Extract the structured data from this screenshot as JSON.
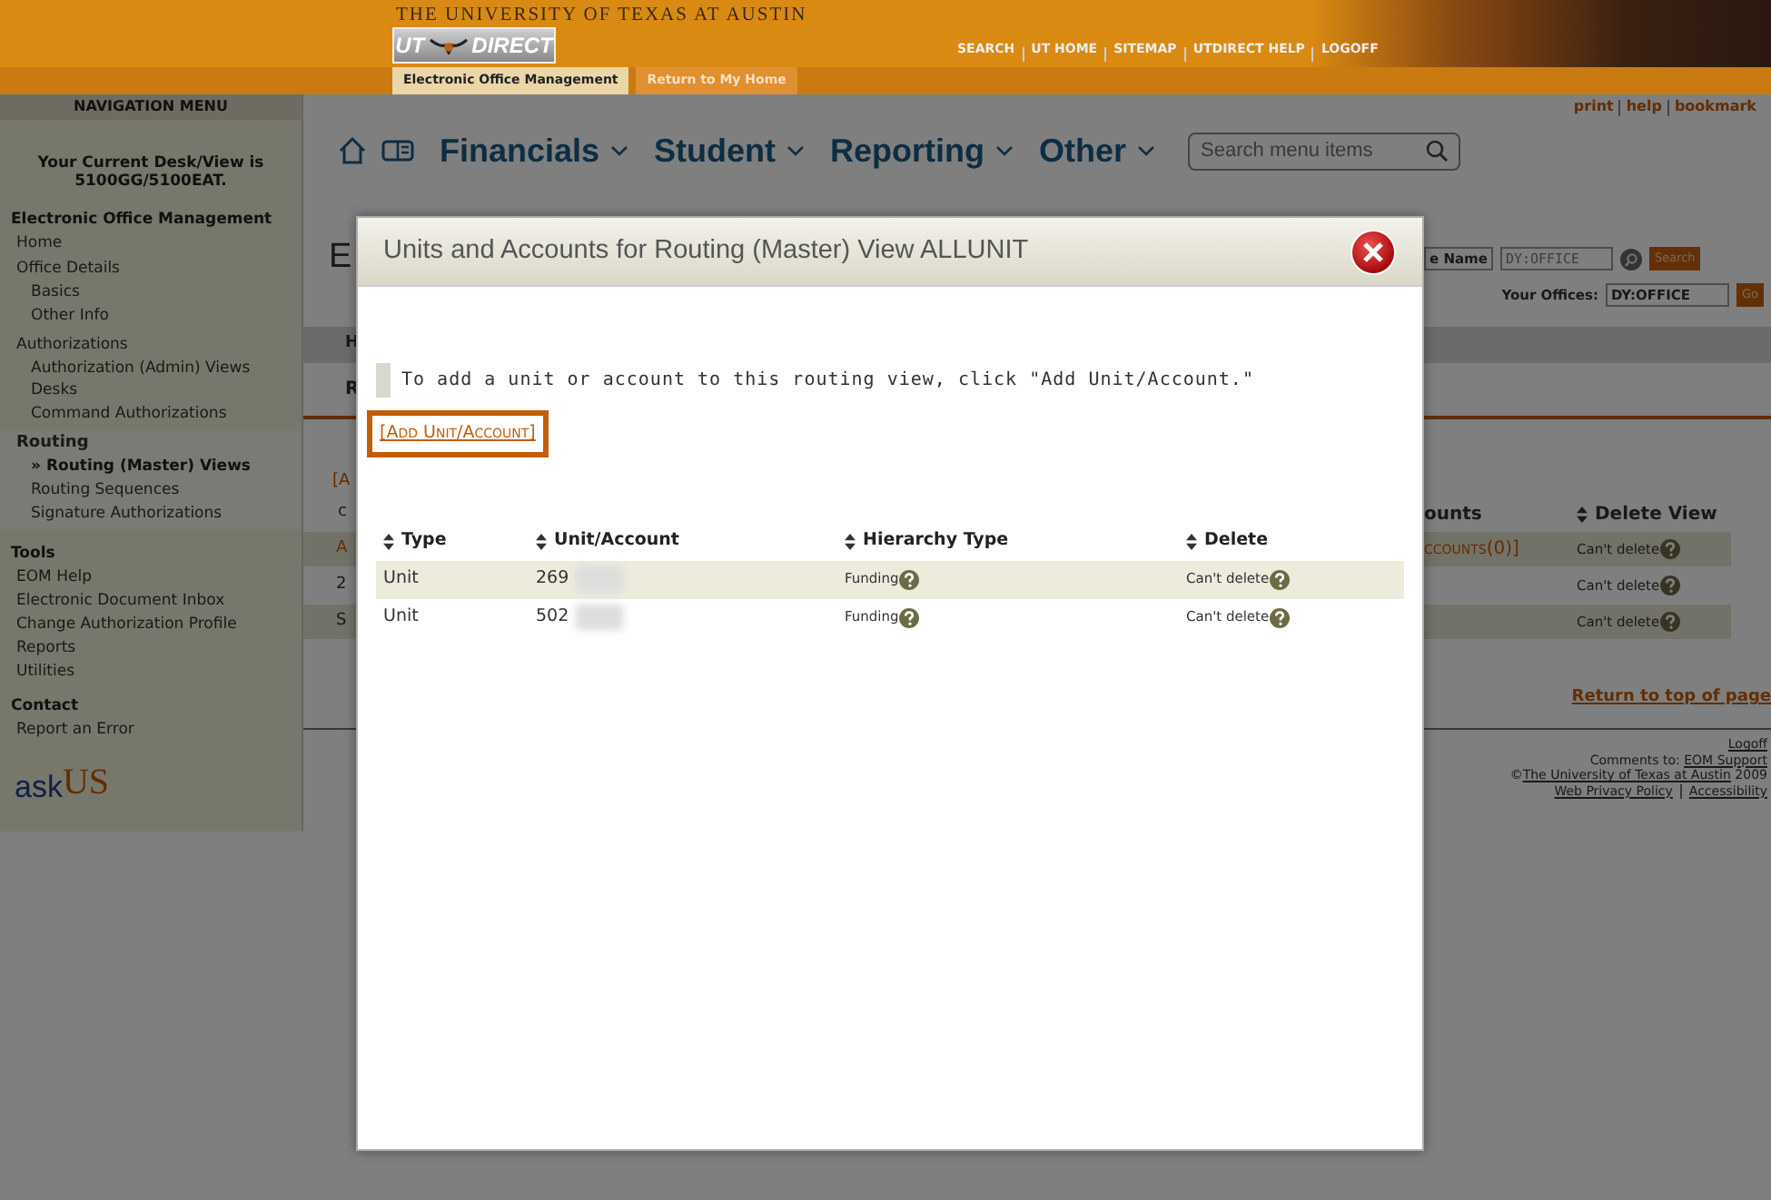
{
  "header": {
    "university": "THE UNIVERSITY OF TEXAS AT AUSTIN",
    "logo": {
      "left": "UT",
      "right": "DIRECT"
    },
    "tabs": [
      {
        "label": "Electronic Office Management",
        "selected": true
      },
      {
        "label": "Return to My Home",
        "selected": false
      }
    ],
    "links": [
      "SEARCH",
      "UT HOME",
      "SITEMAP",
      "UTDIRECT HELP",
      "LOGOFF"
    ]
  },
  "sidebar": {
    "title": "NAVIGATION MENU",
    "current_desk": "Your Current Desk/View is 5100GG/5100EAT.",
    "sections": [
      {
        "heading": "Electronic Office Management",
        "items": [
          {
            "label": "Home",
            "selected": false
          },
          {
            "label": "Office Details",
            "selected": false,
            "children": [
              {
                "label": "Basics",
                "selected": false
              },
              {
                "label": "Other Info",
                "selected": false
              }
            ]
          },
          {
            "label": "Authorizations",
            "selected": false,
            "children": [
              {
                "label": "Authorization (Admin) Views",
                "selected": false
              },
              {
                "label": "Desks",
                "selected": false
              },
              {
                "label": "Command Authorizations",
                "selected": false
              }
            ]
          },
          {
            "label": "Routing",
            "selected": true,
            "children": [
              {
                "label": "» Routing (Master) Views",
                "selected": true
              },
              {
                "label": "Routing Sequences",
                "selected": false
              },
              {
                "label": "Signature Authorizations",
                "selected": false
              }
            ]
          }
        ]
      },
      {
        "heading": "Tools",
        "items": [
          {
            "label": "EOM Help",
            "selected": false
          },
          {
            "label": "Electronic Document Inbox",
            "selected": false
          },
          {
            "label": "Change Authorization Profile",
            "selected": false
          },
          {
            "label": "Reports",
            "selected": false
          },
          {
            "label": "Utilities",
            "selected": false
          }
        ]
      },
      {
        "heading": "Contact",
        "items": [
          {
            "label": "Report an Error",
            "selected": false
          }
        ]
      }
    ],
    "logo": {
      "left": "ask",
      "right": "US"
    }
  },
  "utility_links": [
    "print",
    "help",
    "bookmark"
  ],
  "menu": {
    "items": [
      "Financials",
      "Student",
      "Reporting",
      "Other"
    ],
    "search": {
      "placeholder": "Search menu items"
    }
  },
  "background": {
    "title_fragment": "E",
    "tab_fragments": [
      "H",
      "R"
    ],
    "link_fragment": "[A",
    "header_fragment": "c",
    "row_fragments": [
      "A",
      "2",
      "S"
    ],
    "search_select": "e Name",
    "search_value": "DY:OFFICE",
    "search_button": "Search",
    "offices_label": "Your Offices:",
    "offices_select": "DY:OFFICE",
    "go_button": "Go",
    "columns": [
      "ounts",
      "Delete View"
    ],
    "rows": [
      {
        "accounts": "ccounts(0)]",
        "delete": "Can't delete"
      },
      {
        "accounts": "",
        "delete": "Can't delete"
      },
      {
        "accounts": "",
        "delete": "Can't delete"
      }
    ],
    "return_link": "Return to top of page",
    "footer": {
      "logoff": "Logoff",
      "comments_label": "Comments to:",
      "comments_link": "EOM Support",
      "copyright_symbol": "©",
      "copyright_link": "The University of Texas at Austin",
      "year": "2009",
      "privacy": "Web Privacy Policy",
      "accessibility": "Accessibility"
    }
  },
  "modal": {
    "title": "Units and Accounts for Routing (Master) View ALLUNIT",
    "note": "To add a unit or account to this routing view, click \"Add Unit/Account.\"",
    "add_link": {
      "open": "[",
      "label": "Add Unit/Account",
      "close": "]"
    },
    "table": {
      "columns": [
        "Type",
        "Unit/Account",
        "Hierarchy Type",
        "Delete"
      ],
      "rows": [
        {
          "type": "Unit",
          "unit": "269",
          "hierarchy": "Funding",
          "delete": "Can't delete"
        },
        {
          "type": "Unit",
          "unit": "502",
          "hierarchy": "Funding",
          "delete": "Can't delete"
        }
      ]
    }
  }
}
